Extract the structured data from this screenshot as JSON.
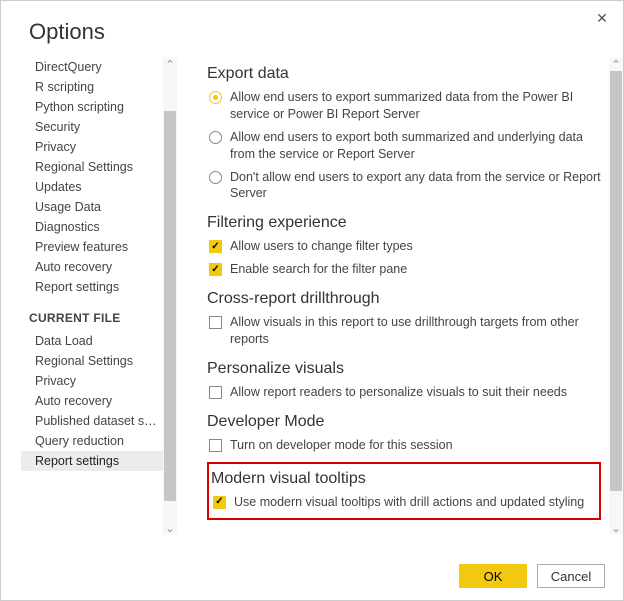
{
  "window": {
    "title": "Options"
  },
  "sidebar": {
    "global_items": [
      "DirectQuery",
      "R scripting",
      "Python scripting",
      "Security",
      "Privacy",
      "Regional Settings",
      "Updates",
      "Usage Data",
      "Diagnostics",
      "Preview features",
      "Auto recovery",
      "Report settings"
    ],
    "current_file_header": "CURRENT FILE",
    "current_file_items": [
      "Data Load",
      "Regional Settings",
      "Privacy",
      "Auto recovery",
      "Published dataset set...",
      "Query reduction",
      "Report settings"
    ],
    "selected": "Report settings"
  },
  "sections": {
    "export": {
      "title": "Export data",
      "options": [
        "Allow end users to export summarized data from the Power BI service or Power BI Report Server",
        "Allow end users to export both summarized and underlying data from the service or Report Server",
        "Don't allow end users to export any data from the service or Report Server"
      ],
      "selected": 0
    },
    "filtering": {
      "title": "Filtering experience",
      "options": [
        "Allow users to change filter types",
        "Enable search for the filter pane"
      ],
      "checked": [
        true,
        true
      ]
    },
    "crossreport": {
      "title": "Cross-report drillthrough",
      "options": [
        "Allow visuals in this report to use drillthrough targets from other reports"
      ],
      "checked": [
        false
      ]
    },
    "personalize": {
      "title": "Personalize visuals",
      "options": [
        "Allow report readers to personalize visuals to suit their needs"
      ],
      "checked": [
        false
      ]
    },
    "developer": {
      "title": "Developer Mode",
      "options": [
        "Turn on developer mode for this session"
      ],
      "checked": [
        false
      ]
    },
    "tooltips": {
      "title": "Modern visual tooltips",
      "options": [
        "Use modern visual tooltips with drill actions and updated styling"
      ],
      "checked": [
        true
      ]
    }
  },
  "buttons": {
    "ok": "OK",
    "cancel": "Cancel"
  }
}
